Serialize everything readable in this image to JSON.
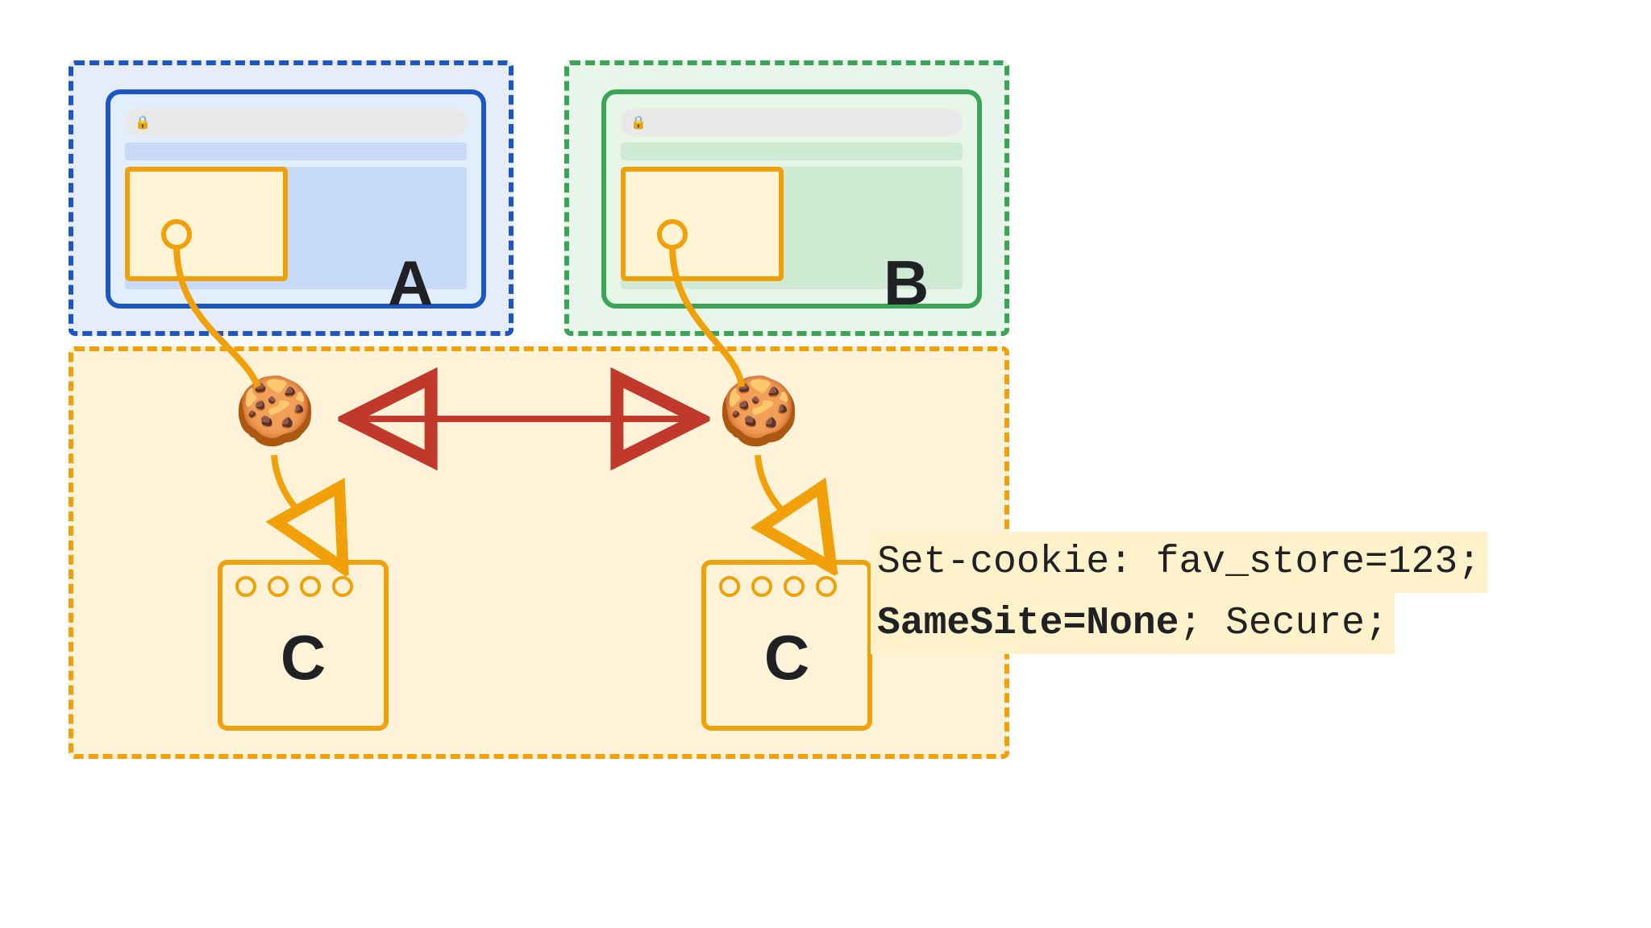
{
  "sites": {
    "a": "A",
    "b": "B",
    "c": "C"
  },
  "code": {
    "line1_prefix": "Set-cookie: fav_store=123;",
    "line2_bold": "SameSite=None",
    "line2_rest": "; Secure;"
  },
  "colors": {
    "blue": "#1a56c4",
    "green": "#3aa655",
    "orange": "#f2a007",
    "red": "#c0392b"
  }
}
